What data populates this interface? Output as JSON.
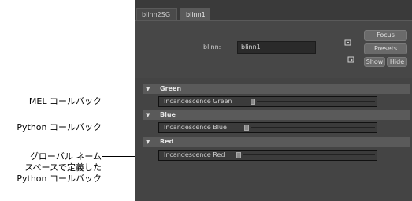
{
  "annotations": {
    "mel": "MEL コールバック",
    "python": "Python コールバック",
    "global_line1": "グローバル ネーム",
    "global_line2": "スペースで定義した",
    "global_line3": "Python コールバック"
  },
  "tabs": [
    {
      "label": "blinn2SG"
    },
    {
      "label": "blinn1"
    }
  ],
  "node": {
    "label": "blinn:",
    "value": "blinn1"
  },
  "buttons": {
    "focus": "Focus",
    "presets": "Presets",
    "show": "Show",
    "hide": "Hide"
  },
  "sections": [
    {
      "title": "Green",
      "row_label": "Incandescence Green"
    },
    {
      "title": "Blue",
      "row_label": "Incandescence Blue"
    },
    {
      "title": "Red",
      "row_label": "Incandescence Red"
    }
  ],
  "icons": {
    "section_toggle": "triangle-down-icon",
    "load_icon": "load-attributes-icon",
    "copy_icon": "copy-tab-icon"
  }
}
